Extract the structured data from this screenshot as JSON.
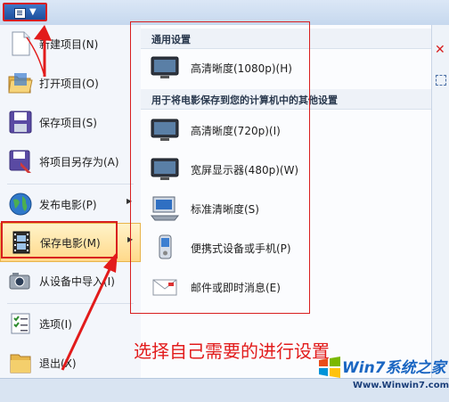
{
  "left_menu": {
    "items": [
      {
        "label": "新建项目(N)",
        "icon": "new-document-icon"
      },
      {
        "label": "打开项目(O)",
        "icon": "open-folder-icon"
      },
      {
        "label": "保存项目(S)",
        "icon": "save-disk-icon"
      },
      {
        "label": "将项目另存为(A)",
        "icon": "save-as-icon"
      },
      {
        "label": "发布电影(P)",
        "icon": "globe-publish-icon"
      },
      {
        "label": "保存电影(M)",
        "icon": "film-save-icon"
      },
      {
        "label": "从设备中导入(I)",
        "icon": "camera-import-icon"
      },
      {
        "label": "选项(I)",
        "icon": "options-list-icon"
      },
      {
        "label": "退出(X)",
        "icon": "exit-folder-icon"
      }
    ]
  },
  "submenu": {
    "section_common": "通用设置",
    "section_other": "用于将电影保存到您的计算机中的其他设置",
    "items": [
      {
        "label": "高清晰度(1080p)(H)",
        "icon": "monitor-icon"
      },
      {
        "label": "高清晰度(720p)(I)",
        "icon": "monitor-icon"
      },
      {
        "label": "宽屏显示器(480p)(W)",
        "icon": "monitor-icon"
      },
      {
        "label": "标准清晰度(S)",
        "icon": "computer-icon"
      },
      {
        "label": "便携式设备或手机(P)",
        "icon": "phone-icon"
      },
      {
        "label": "邮件或即时消息(E)",
        "icon": "email-icon"
      }
    ]
  },
  "annotation": {
    "text": "选择自己需要的进行设置",
    "color": "#e21b1b"
  },
  "watermark": {
    "title": "Win7系统之家",
    "url": "Www.Winwin7.com"
  },
  "colors": {
    "highlight": "#ffd98a",
    "annotation_red": "#d81f1f"
  }
}
